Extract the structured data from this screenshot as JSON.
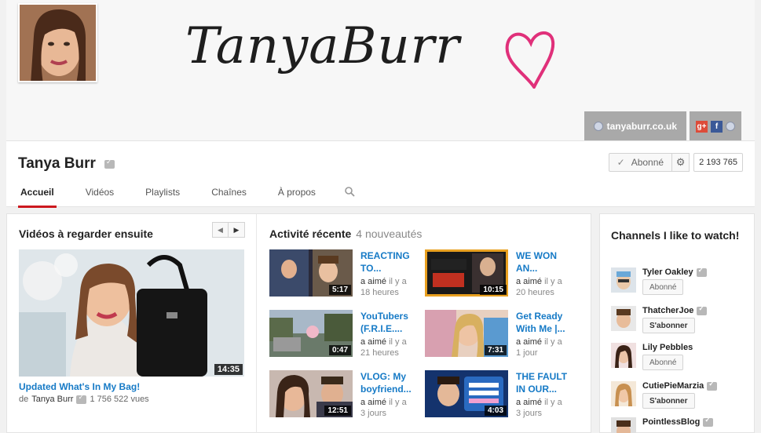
{
  "banner": {
    "title": "TanyaBurr",
    "site_link": "tanyaburr.co.uk",
    "social": [
      "google-plus",
      "facebook",
      "web"
    ]
  },
  "channel": {
    "name": "Tanya Burr",
    "subscribe_label": "Abonné",
    "subscriber_count": "2 193 765"
  },
  "tabs": [
    {
      "label": "Accueil",
      "active": true
    },
    {
      "label": "Vidéos"
    },
    {
      "label": "Playlists"
    },
    {
      "label": "Chaînes"
    },
    {
      "label": "À propos"
    }
  ],
  "watch_next": {
    "title": "Vidéos à regarder ensuite",
    "video": {
      "title": "Updated What's In My Bag!",
      "author_prefix": "de",
      "author": "Tanya Burr",
      "views": "1 756 522 vues",
      "duration": "14:35"
    }
  },
  "activity": {
    "title": "Activité récente",
    "count": "4 nouveautés",
    "items": [
      {
        "title_1": "REACTING",
        "title_2": "TO...",
        "who": "a aimé",
        "time_1": "il y a",
        "time_2": "18 heures",
        "duration": "5:17"
      },
      {
        "title_1": "WE WON",
        "title_2": "AN...",
        "who": "a aimé",
        "time_1": "il y a",
        "time_2": "20 heures",
        "duration": "10:15"
      },
      {
        "title_1": "YouTubers",
        "title_2": "(F.R.I.E....",
        "who": "a aimé",
        "time_1": "il y a",
        "time_2": "21 heures",
        "duration": "0:47"
      },
      {
        "title_1": "Get Ready",
        "title_2": "With Me |...",
        "who": "a aimé",
        "time_1": "il y a",
        "time_2": "1 jour",
        "duration": "7:31"
      },
      {
        "title_1": "VLOG: My",
        "title_2": "boyfriend...",
        "who": "a aimé",
        "time_1": "il y a",
        "time_2": "3 jours",
        "duration": "12:51"
      },
      {
        "title_1": "THE FAULT",
        "title_2": "IN OUR...",
        "who": "a aimé",
        "time_1": "il y a",
        "time_2": "3 jours",
        "duration": "4:03"
      }
    ]
  },
  "sidebar": {
    "title": "Channels I like to watch!",
    "channels": [
      {
        "name": "Tyler Oakley",
        "button": "Abonné"
      },
      {
        "name": "ThatcherJoe",
        "button": "S'abonner"
      },
      {
        "name": "Lily Pebbles",
        "button": "Abonné"
      },
      {
        "name": "CutiePieMarzia",
        "button": "S'abonner"
      },
      {
        "name": "PointlessBlog",
        "button": ""
      }
    ]
  },
  "colors": {
    "accent": "#cc181e",
    "link": "#167ac6",
    "heart": "#e0307a"
  }
}
